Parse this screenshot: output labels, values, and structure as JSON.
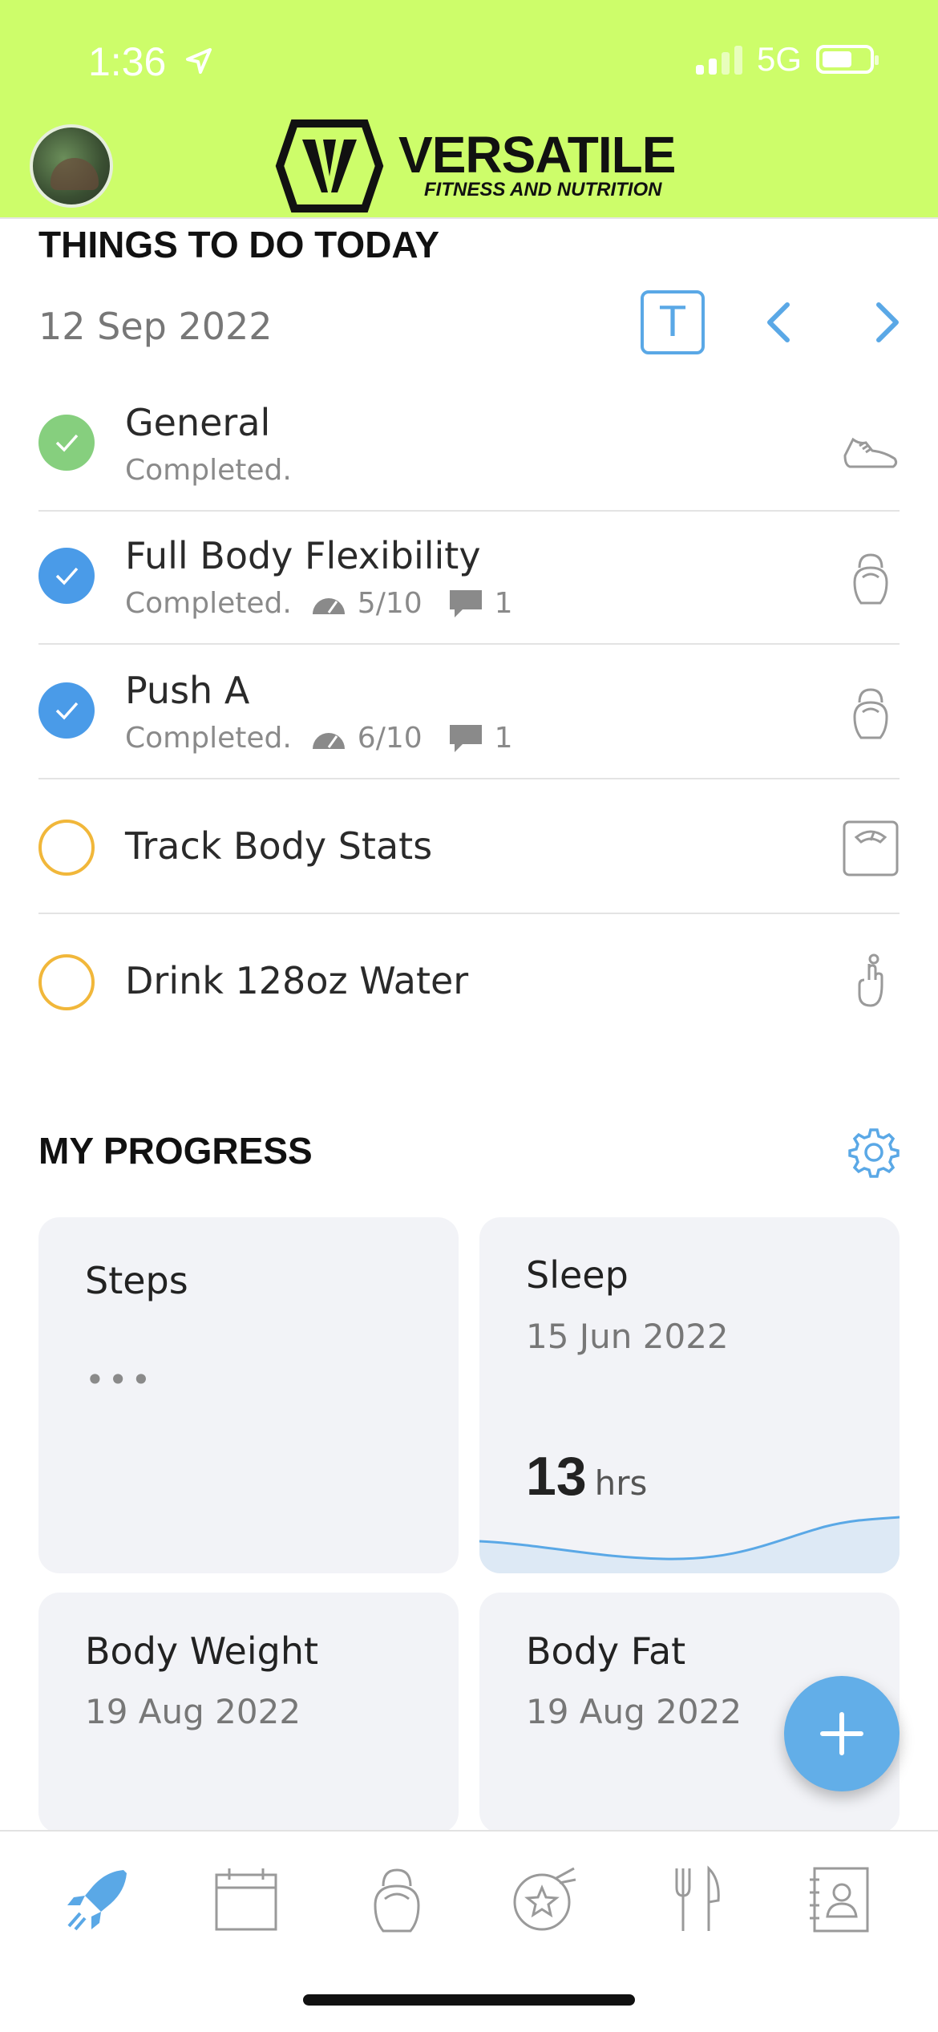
{
  "status": {
    "time": "1:36",
    "network": "5G"
  },
  "header": {
    "brand": "VERSATILE",
    "tagline": "FITNESS AND NUTRITION"
  },
  "todo": {
    "title": "THINGS TO DO TODAY",
    "date": "12 Sep 2022",
    "today_label": "T",
    "tasks": [
      {
        "title": "General",
        "status": "Completed.",
        "icon": "sneaker-icon",
        "state": "done-green"
      },
      {
        "title": "Full Body Flexibility",
        "status": "Completed.",
        "rating": "5/10",
        "comments": "1",
        "icon": "kettlebell-icon",
        "state": "done-blue"
      },
      {
        "title": "Push A",
        "status": "Completed.",
        "rating": "6/10",
        "comments": "1",
        "icon": "kettlebell-icon",
        "state": "done-blue"
      },
      {
        "title": "Track Body Stats",
        "icon": "scale-icon",
        "state": "pending"
      },
      {
        "title": "Drink 128oz Water",
        "icon": "finger-reminder-icon",
        "state": "pending"
      }
    ]
  },
  "progress": {
    "title": "MY PROGRESS",
    "cards": [
      {
        "title": "Steps",
        "placeholder": "•••"
      },
      {
        "title": "Sleep",
        "date": "15 Jun 2022",
        "value": "13",
        "unit": "hrs"
      },
      {
        "title": "Body Weight",
        "date": "19 Aug 2022"
      },
      {
        "title": "Body Fat",
        "date": "19 Aug 2022"
      }
    ]
  },
  "colors": {
    "header_bg": "#cdfd6a",
    "accent_blue": "#5aa8e6",
    "done_green": "#86cf7e",
    "pending_orange": "#f1b73a"
  },
  "tabs": [
    "rocket-icon",
    "calendar-icon",
    "kettlebell-icon",
    "star-badge-icon",
    "fork-knife-icon",
    "contact-book-icon"
  ]
}
